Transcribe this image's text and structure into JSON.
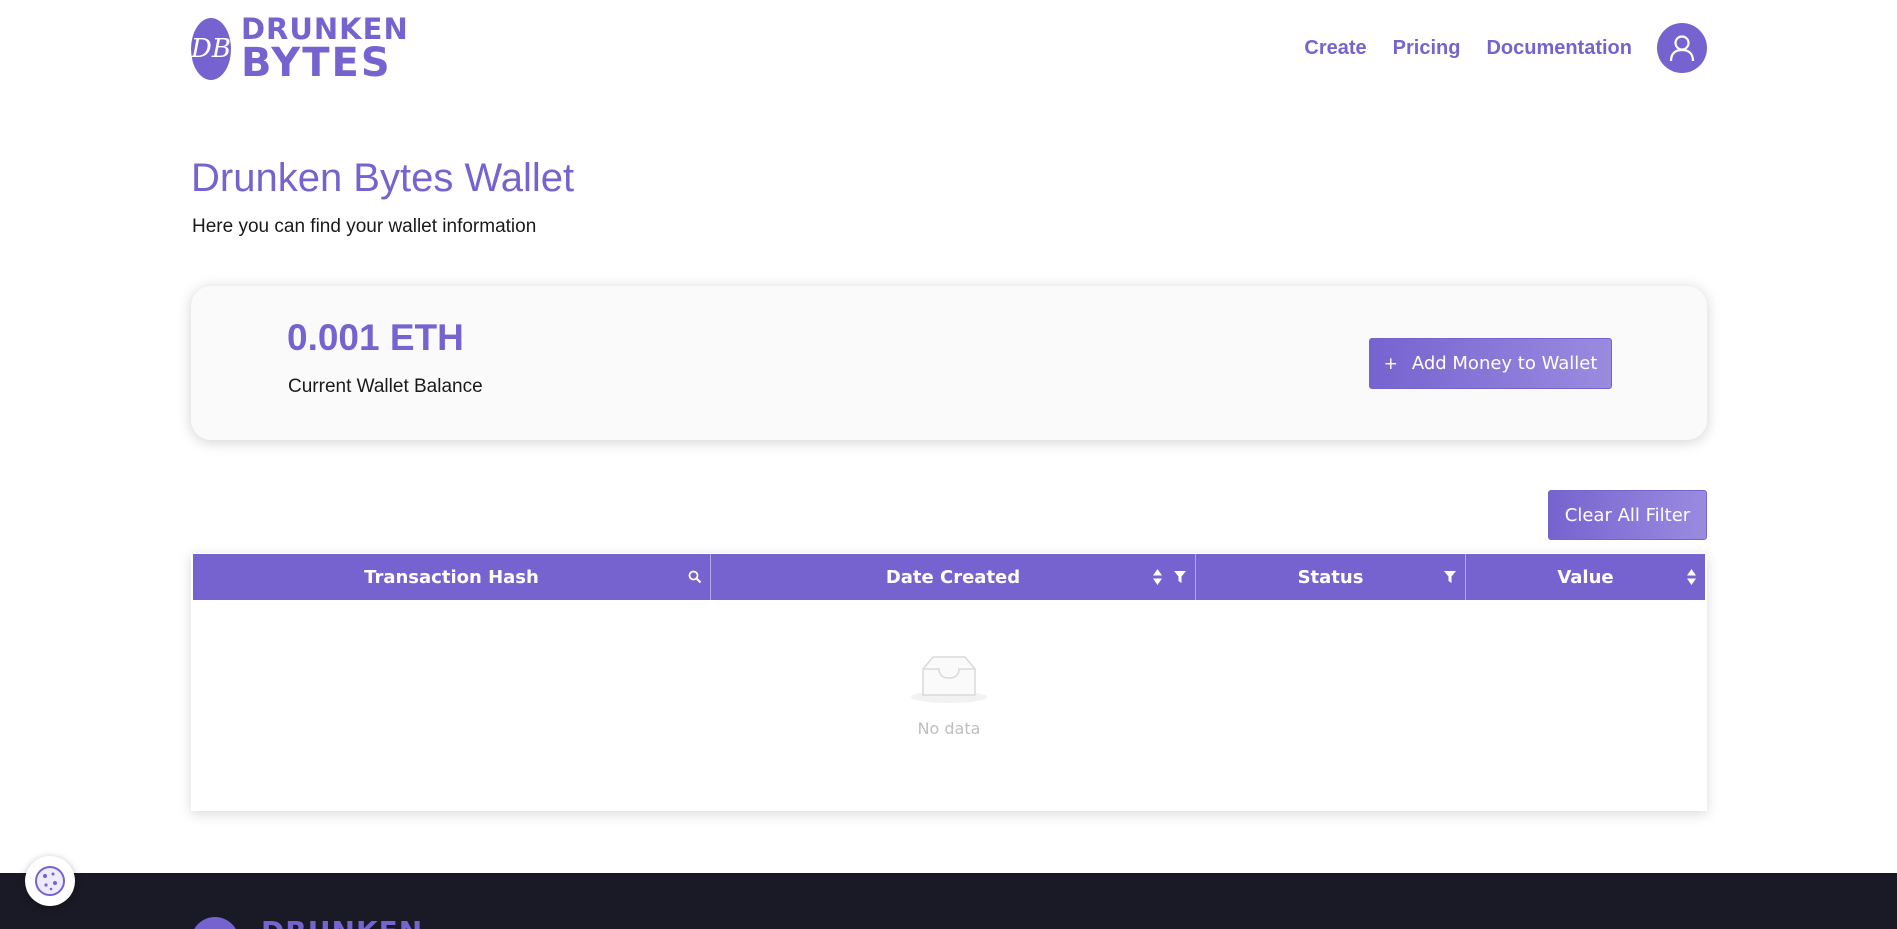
{
  "brand": {
    "monogram": "DB",
    "name_line1": "DRUNKEN",
    "name_line2": "BYTES"
  },
  "nav": {
    "items": [
      {
        "label": "Create"
      },
      {
        "label": "Pricing"
      },
      {
        "label": "Documentation"
      }
    ],
    "avatar_icon": "user-icon"
  },
  "page": {
    "title": "Drunken Bytes Wallet",
    "subtitle": "Here you can find your wallet information"
  },
  "wallet": {
    "balance": "0.001 ETH",
    "balance_label": "Current Wallet Balance",
    "add_button_icon": "+",
    "add_button_label": "Add Money to Wallet"
  },
  "table": {
    "clear_filter_label": "Clear All Filter",
    "columns": [
      {
        "label": "Transaction Hash",
        "icons": [
          "search-icon"
        ]
      },
      {
        "label": "Date Created",
        "icons": [
          "sort-icon",
          "filter-icon"
        ]
      },
      {
        "label": "Status",
        "icons": [
          "filter-icon"
        ]
      },
      {
        "label": "Value",
        "icons": [
          "sort-icon"
        ]
      }
    ],
    "empty_text": "No data"
  },
  "footer": {
    "brand_text": "DRUNKEN"
  },
  "colors": {
    "accent": "#7763cf",
    "footer_bg": "#1a1a26"
  }
}
